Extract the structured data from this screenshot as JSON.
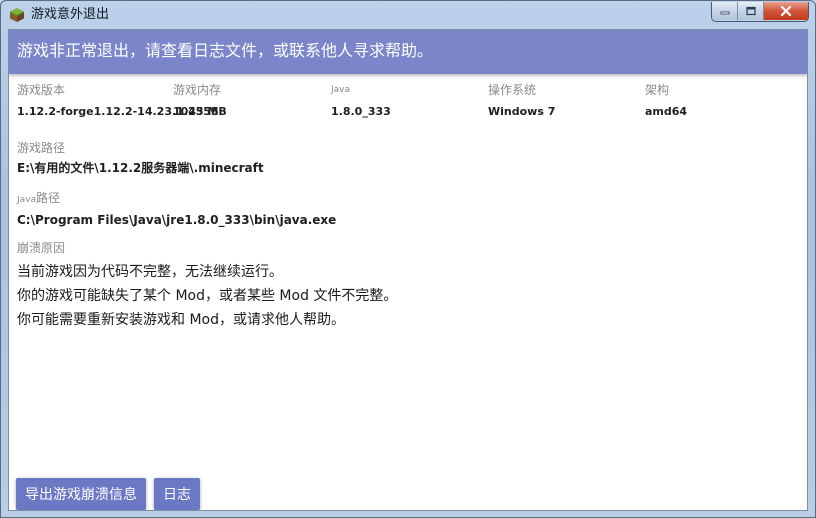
{
  "window": {
    "title": "游戏意外退出",
    "icon": "minecraft-grass-block-icon"
  },
  "banner": {
    "message": "游戏非正常退出，请查看日志文件，或联系他人寻求帮助。",
    "color": "#7a86c9"
  },
  "info": {
    "game_version": {
      "label": "游戏版本",
      "value": "1.12.2-forge1.12.2-14.23.1.2555"
    },
    "game_memory": {
      "label": "游戏内存",
      "value": "1043 MB"
    },
    "java": {
      "label": "Java",
      "value": "1.8.0_333"
    },
    "os": {
      "label": "操作系统",
      "value": "Windows 7"
    },
    "arch": {
      "label": "架构",
      "value": "amd64"
    }
  },
  "game_path": {
    "label": "游戏路径",
    "value": "E:\\有用的文件\\1.12.2服务器端\\.minecraft"
  },
  "java_path": {
    "label_prefix": "Java",
    "label_suffix": "路径",
    "value": "C:\\Program Files\\Java\\jre1.8.0_333\\bin\\java.exe"
  },
  "crash_reason": {
    "label": "崩溃原因",
    "lines": [
      "当前游戏因为代码不完整，无法继续运行。",
      "你的游戏可能缺失了某个 Mod，或者某些 Mod 文件不完整。",
      "你可能需要重新安装游戏和 Mod，或请求他人帮助。"
    ]
  },
  "buttons": {
    "export": "导出游戏崩溃信息",
    "log": "日志"
  }
}
